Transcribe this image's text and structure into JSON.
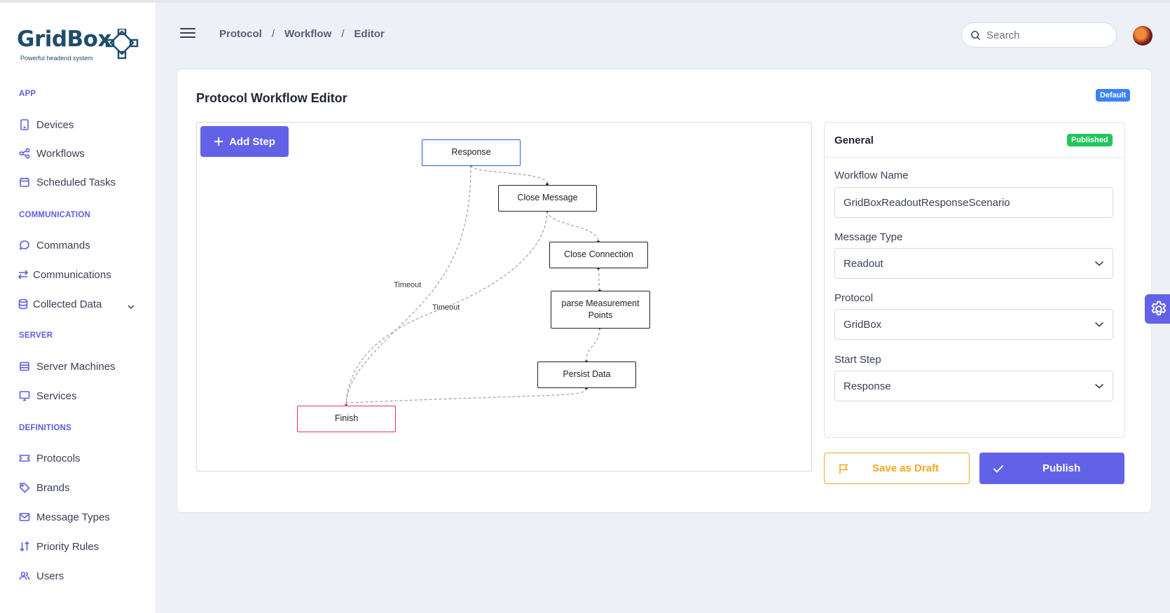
{
  "app": {
    "logo_text": "GridBox",
    "logo_tagline": "Powerful headend system"
  },
  "sidebar": {
    "sections": [
      {
        "label": "APP"
      },
      {
        "label": "COMMUNICATION"
      },
      {
        "label": "SERVER"
      },
      {
        "label": "DEFINITIONS"
      }
    ],
    "items": [
      {
        "label": "Devices",
        "icon": "tablet-icon"
      },
      {
        "label": "Workflows",
        "icon": "share-icon"
      },
      {
        "label": "Scheduled Tasks",
        "icon": "calendar-icon"
      },
      {
        "label": "Commands",
        "icon": "chat-icon"
      },
      {
        "label": "Communications",
        "icon": "swap-icon"
      },
      {
        "label": "Collected Data",
        "icon": "database-icon"
      },
      {
        "label": "Server Machines",
        "icon": "server-icon"
      },
      {
        "label": "Services",
        "icon": "monitor-icon"
      },
      {
        "label": "Protocols",
        "icon": "ticket-icon"
      },
      {
        "label": "Brands",
        "icon": "tag-icon"
      },
      {
        "label": "Message Types",
        "icon": "mail-icon"
      },
      {
        "label": "Priority Rules",
        "icon": "sort-icon"
      },
      {
        "label": "Users",
        "icon": "users-icon"
      }
    ]
  },
  "header": {
    "breadcrumb": [
      "Protocol",
      "Workflow",
      "Editor"
    ],
    "breadcrumb_sep": "/",
    "search_placeholder": "Search"
  },
  "editor": {
    "title": "Protocol Workflow Editor",
    "badge": "Default",
    "add_step_label": "Add Step",
    "nodes": {
      "response": "Response",
      "close_message": "Close Message",
      "close_connection": "Close Connection",
      "parse_points": "parse Measurement Points",
      "persist_data": "Persist Data",
      "finish": "Finish"
    },
    "edge_labels": [
      "Timeout",
      "Timeout"
    ]
  },
  "general": {
    "title": "General",
    "status_badge": "Published",
    "workflow_name_label": "Workflow Name",
    "workflow_name_value": "GridBoxReadoutResponseScenario",
    "message_type_label": "Message Type",
    "message_type_value": "Readout",
    "protocol_label": "Protocol",
    "protocol_value": "GridBox",
    "start_step_label": "Start Step",
    "start_step_value": "Response"
  },
  "actions": {
    "save_draft_label": "Save as Draft",
    "publish_label": "Publish"
  },
  "colors": {
    "accent": "#6262e8",
    "draft": "#f5a623",
    "published": "#22c55e",
    "default_badge": "#3b82f6",
    "finish_border": "#e62e7b",
    "start_border": "#2b5fd9"
  }
}
